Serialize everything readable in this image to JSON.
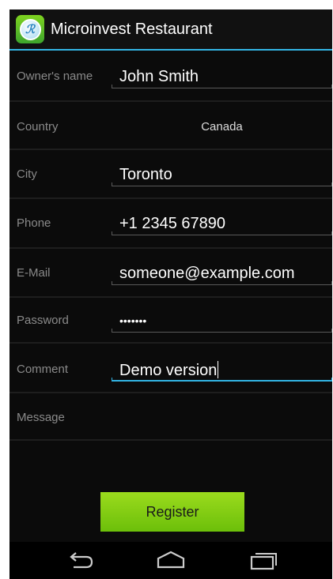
{
  "app": {
    "title": "Microinvest Restaurant",
    "icon": "restaurant-logo-icon"
  },
  "form": {
    "owner_name": {
      "label": "Owner's name",
      "value": "John Smith"
    },
    "country": {
      "label": "Country",
      "value": "Canada"
    },
    "city": {
      "label": "City",
      "value": "Toronto"
    },
    "phone": {
      "label": "Phone",
      "value": "+1 2345 67890"
    },
    "email": {
      "label": "E-Mail",
      "value": "someone@example.com"
    },
    "password": {
      "label": "Password",
      "value": "•••••••"
    },
    "comment": {
      "label": "Comment",
      "value": "Demo version"
    },
    "message": {
      "label": "Message"
    }
  },
  "register_label": "Register",
  "navbar": {
    "icons": [
      "back-icon",
      "home-icon",
      "recent-apps-icon"
    ]
  },
  "colors": {
    "accent": "#33b5e5",
    "register_button": "#8bd31a",
    "background": "#0b0b0b"
  }
}
